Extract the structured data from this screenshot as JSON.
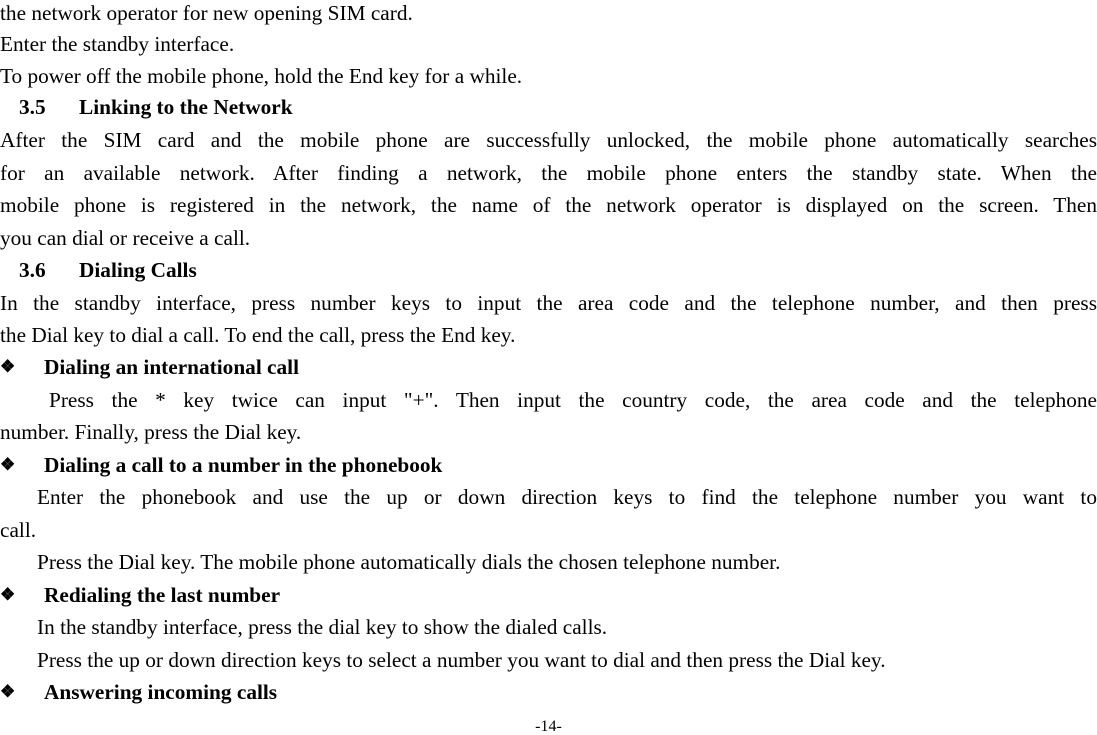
{
  "lines": {
    "l1": "the network operator for new opening SIM card.",
    "l2": "Enter the standby interface.",
    "l3": "To power off the mobile phone, hold the End key for a while."
  },
  "section_35": {
    "number": "3.5",
    "title": "Linking to the Network",
    "p1": "After the SIM card and the mobile phone are successfully unlocked, the mobile phone automatically searches",
    "p2": "for an available network. After finding a network, the mobile phone enters the standby state. When the",
    "p3": "mobile phone is registered in the network, the name of the network operator is displayed on the screen. Then",
    "p4": "you can dial or receive a call."
  },
  "section_36": {
    "number": "3.6",
    "title": "Dialing Calls",
    "p1": "In the standby interface, press number keys to input the area code and the telephone number, and then press",
    "p2": "the Dial key to dial a call. To end the call, press the End key."
  },
  "bullet_glyph": "❖",
  "bullets": {
    "international": {
      "title": "Dialing an international call",
      "l1": "Press the * key twice can input \"+\". Then input the country code, the area code and the telephone",
      "l2": "number. Finally, press the Dial key."
    },
    "phonebook": {
      "title": "Dialing a call to a number in the phonebook",
      "l1": "Enter the phonebook and use the up or down direction keys to find the telephone number you want to",
      "l2": "call.",
      "l3": "Press the Dial key. The mobile phone automatically dials the chosen telephone number."
    },
    "redial": {
      "title": "Redialing the last number",
      "l1": "In the standby interface, press the dial key to show the dialed calls.",
      "l2": "Press the up or down direction keys to select a number you want to dial and then press the Dial key."
    },
    "answering": {
      "title": "Answering incoming calls"
    }
  },
  "page_number": "-14-"
}
